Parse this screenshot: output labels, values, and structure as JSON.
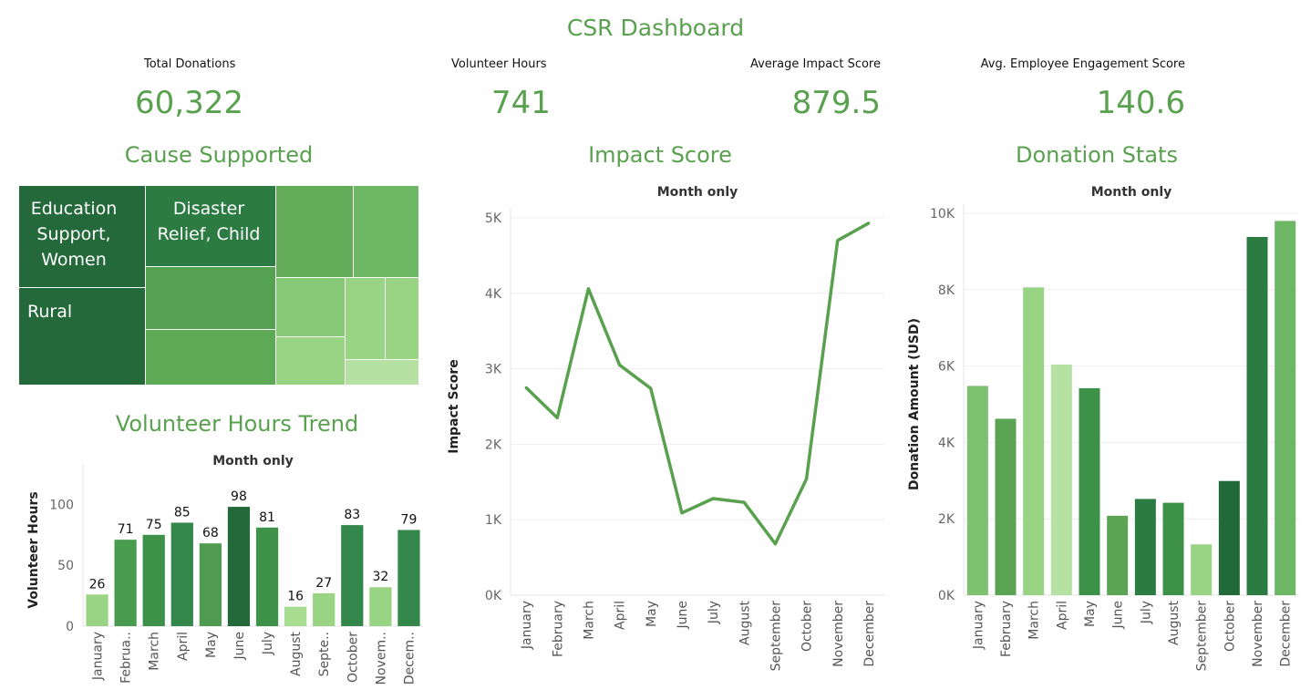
{
  "dashboard_title": "CSR Dashboard",
  "colors": {
    "accent": "#59a14f"
  },
  "kpis": [
    {
      "label": "Total Donations",
      "value": "60,322"
    },
    {
      "label": "Volunteer Hours",
      "value": "741"
    },
    {
      "label": "Average Impact Score",
      "value": "879.5"
    },
    {
      "label": "Avg. Employee Engagement Score",
      "value": "140.6"
    }
  ],
  "sections": {
    "cause": "Cause Supported",
    "volunteer": "Volunteer Hours Trend",
    "impact": "Impact Score",
    "donation": "Donation Stats"
  },
  "treemap": {
    "labels": [
      "Education Support, Women",
      "Disaster Relief, Child",
      "Rural"
    ]
  },
  "chart_data": [
    {
      "id": "volunteer",
      "type": "bar",
      "title": "Month only",
      "ylabel": "Volunteer Hours",
      "ylim": [
        0,
        125
      ],
      "yticks": [
        "0",
        "50",
        "100"
      ],
      "categories": [
        "January",
        "Februa..",
        "March",
        "April",
        "May",
        "June",
        "July",
        "August",
        "Septe..",
        "October",
        "Novem..",
        "Decem.."
      ],
      "values": [
        26,
        71,
        75,
        85,
        68,
        98,
        81,
        16,
        27,
        83,
        32,
        79
      ],
      "bar_colors": [
        "#98d484",
        "#499c4e",
        "#3e9149",
        "#33874a",
        "#4e9b51",
        "#24693a",
        "#3e9149",
        "#a8dd92",
        "#98d484",
        "#33874a",
        "#98d484",
        "#33874a"
      ]
    },
    {
      "id": "impact",
      "type": "line",
      "title": "Month only",
      "ylabel": "Impact Score",
      "ylim": [
        0,
        5000
      ],
      "yticks": [
        "0K",
        "1K",
        "2K",
        "3K",
        "4K",
        "5K"
      ],
      "categories": [
        "January",
        "February",
        "March",
        "April",
        "May",
        "June",
        "July",
        "August",
        "September",
        "October",
        "November",
        "December"
      ],
      "values": [
        2750,
        2350,
        4060,
        3050,
        2740,
        1090,
        1280,
        1230,
        680,
        1540,
        4700,
        4930
      ],
      "line_color": "#59a14f"
    },
    {
      "id": "donation",
      "type": "bar",
      "title": "Month only",
      "ylabel": "Donation Amount (USD)",
      "ylim": [
        0,
        10000
      ],
      "yticks": [
        "0K",
        "2K",
        "4K",
        "6K",
        "8K",
        "10K"
      ],
      "categories": [
        "January",
        "February",
        "March",
        "April",
        "May",
        "June",
        "July",
        "August",
        "September",
        "October",
        "November",
        "December"
      ],
      "values": [
        5480,
        4620,
        8060,
        6040,
        5420,
        2080,
        2520,
        2420,
        1330,
        2990,
        9380,
        9800
      ],
      "bar_colors": [
        "#7dc06d",
        "#5ba454",
        "#98d484",
        "#b5e2a2",
        "#3e9149",
        "#5ba454",
        "#2c7b42",
        "#3e9149",
        "#98d484",
        "#226939",
        "#2c7b42",
        "#6db765"
      ]
    }
  ]
}
